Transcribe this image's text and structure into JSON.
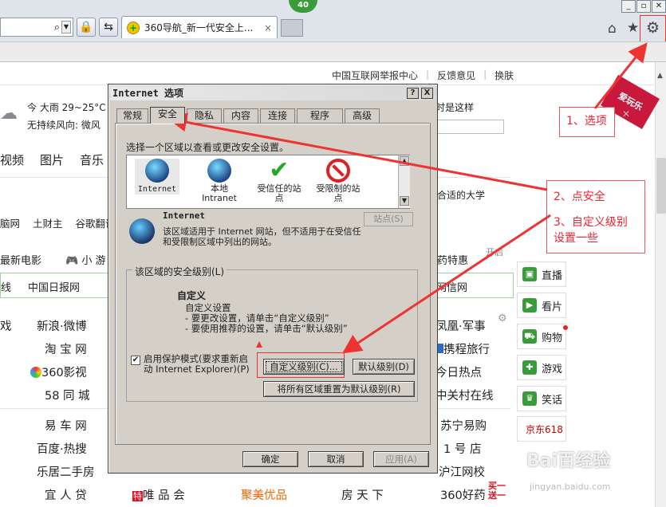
{
  "browser": {
    "tab_count_badge": "40",
    "tab_title": "360导航_新一代安全上...",
    "tab_close": "×",
    "win_min": "_",
    "win_restore": "▫",
    "win_close": "✕"
  },
  "page": {
    "toplinks": [
      "中国互联网举报中心",
      "反馈意见",
      "换肤"
    ],
    "weather_line1": "今 大雨  29~25°C",
    "weather_line2": "无持续风向: 微风",
    "nav": [
      "视频",
      "图片",
      "音乐"
    ],
    "row2": [
      "脑网",
      "土财主",
      "谷歌翻译"
    ],
    "row3_left": "最新电影",
    "row3_game": "小 游",
    "greenbar": [
      "线",
      "中国日报网",
      "网信网"
    ],
    "sites": [
      {
        "col1": "戏",
        "col2": "新浪·微博"
      },
      {
        "col1": "",
        "col2": "淘 宝 网"
      },
      {
        "col1": "",
        "col2": "360影视"
      },
      {
        "col1": "",
        "col2": "58 同 城"
      },
      {
        "col1": "",
        "col2": "易 车 网"
      },
      {
        "col1": "",
        "col2": "百度·热搜"
      },
      {
        "col1": "",
        "col2": "乐居二手房"
      },
      {
        "col1": "",
        "col2": "宜 人 贷"
      }
    ],
    "right_sites": [
      "凤凰·军事",
      "携程旅行",
      "今日热点",
      "中关村在线",
      "苏宁易购",
      "1 号 店",
      "沪江网校"
    ],
    "bottom_row": [
      "唯 品 会",
      "聚美优品",
      "房 天 下",
      "360好药"
    ],
    "bottom_tag": "特",
    "buy_promo": "买一送一",
    "right_text1": "时是这样",
    "right_text2": "合适的大学",
    "right_text3": "药特惠",
    "kaiqi": "开启",
    "sidebar": [
      "直播",
      "看片",
      "购物",
      "游戏",
      "笑话"
    ],
    "jd": "京东618",
    "ribbon": "爱玩乐"
  },
  "dialog": {
    "title": "Internet 选项",
    "help_btn": "?",
    "close_btn": "X",
    "tabs": [
      "常规",
      "安全",
      "隐私",
      "内容",
      "连接",
      "程序",
      "高级"
    ],
    "zone_prompt": "选择一个区域以查看或更改安全设置。",
    "zones": [
      {
        "label": "Internet"
      },
      {
        "label": "本地\nIntranet"
      },
      {
        "label": "受信任的站\n点"
      },
      {
        "label": "受限制的站\n点"
      }
    ],
    "zone_info_title": "Internet",
    "zone_info_desc": "该区域适用于 Internet 网站，但不适用于在受信任和受限制区域中列出的网站。",
    "sites_btn": "站点(S)",
    "security_level_label": "该区域的安全级别(L)",
    "custom_title": "自定义",
    "custom_desc": "自定义设置\n- 要更改设置，请单击“自定义级别”\n- 要使用推荐的设置，请单击“默认级别”",
    "protected_mode": "启用保护模式(要求重新启\n动 Internet Explorer)(P)",
    "custom_level_btn": "自定义级别(C)...",
    "default_level_btn": "默认级别(D)",
    "reset_all_btn": "将所有区域重置为默认级别(R)",
    "ok_btn": "确定",
    "cancel_btn": "取消",
    "apply_btn": "应用(A)"
  },
  "annotations": {
    "step1": "1、选项",
    "step2": "2、点安全",
    "step3": "3、自定义级别\n设置一些"
  },
  "watermark": "Bai百经验",
  "watermark_url": "jingyan.baidu.com",
  "colors": {
    "annotation": "#e33333",
    "dialog_bg": "#d4d0c8",
    "green": "#3a9b3a"
  }
}
